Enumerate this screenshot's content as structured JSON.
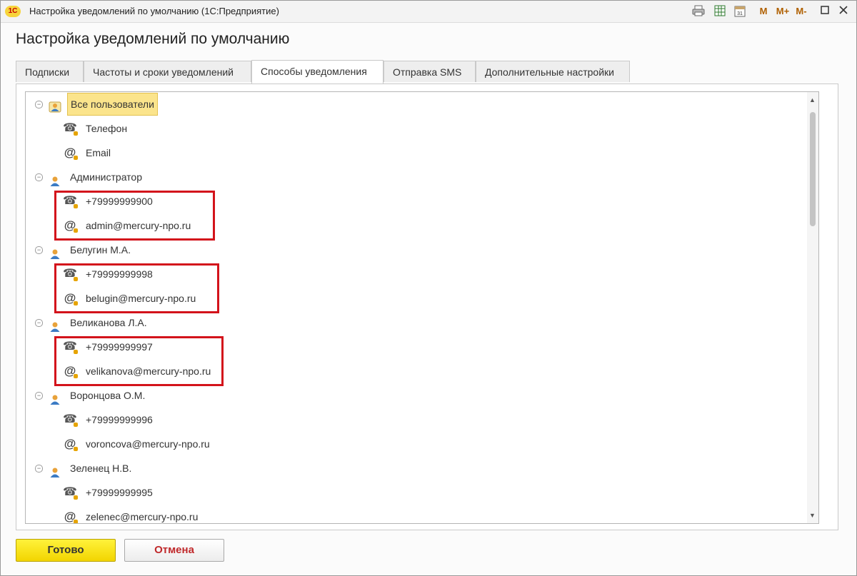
{
  "window": {
    "title": "Настройка уведомлений по умолчанию  (1С:Предприятие)",
    "logo": "1С",
    "toolbar": {
      "memory_m": "M",
      "memory_plus": "M+",
      "memory_minus": "M-",
      "calendar_day": "31"
    }
  },
  "form_title": "Настройка уведомлений по умолчанию",
  "tabs": [
    {
      "label": "Подписки"
    },
    {
      "label": "Частоты и сроки уведомлений"
    },
    {
      "label": "Способы уведомления",
      "active": true
    },
    {
      "label": "Отправка SMS"
    },
    {
      "label": "Дополнительные настройки"
    }
  ],
  "tree": {
    "all_users": {
      "label": "Все пользователи",
      "phone": "Телефон",
      "email": "Email"
    },
    "users": [
      {
        "name": "Администратор",
        "phone": "+79999999900",
        "email": "admin@mercury-npo.ru",
        "highlighted": true
      },
      {
        "name": "Белугин М.А.",
        "phone": "+79999999998",
        "email": "belugin@mercury-npo.ru",
        "highlighted": true
      },
      {
        "name": "Великанова Л.А.",
        "phone": "+79999999997",
        "email": "velikanova@mercury-npo.ru",
        "highlighted": true
      },
      {
        "name": "Воронцова О.М.",
        "phone": "+79999999996",
        "email": "voroncova@mercury-npo.ru",
        "highlighted": false
      },
      {
        "name": "Зеленец Н.В.",
        "phone": "+79999999995",
        "email": "zelenec@mercury-npo.ru",
        "highlighted": false
      }
    ]
  },
  "buttons": {
    "ok": "Готово",
    "cancel": "Отмена"
  },
  "icons": {
    "phone": "telephone-icon",
    "email": "at-sign-icon",
    "user": "user-icon",
    "group": "user-group-icon"
  },
  "colors": {
    "highlight_border": "#d3131b",
    "selected_bg": "#fbe48c",
    "ok_button": "#f7e21a",
    "cancel_text": "#c0292b"
  }
}
